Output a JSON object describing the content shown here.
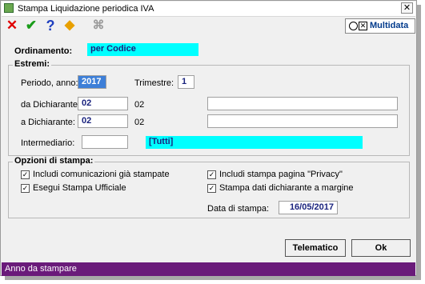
{
  "window": {
    "title": "Stampa Liquidazione periodica IVA",
    "close_label": "✕"
  },
  "toolbar": {
    "cancel_icon": "✕",
    "confirm_icon": "✔",
    "help_icon": "?",
    "tool_icon": "◆",
    "binoculars_icon": "⌘",
    "brand_box": "✕",
    "brand_text": "Multidata"
  },
  "ordinamento": {
    "label": "Ordinamento:",
    "value": "per Codice"
  },
  "estremi": {
    "title": "Estremi:",
    "periodo_label": "Periodo, anno:",
    "anno_value": "2017",
    "trimestre_label": "Trimestre:",
    "trimestre_value": "1",
    "da_label": "da Dichiarante:",
    "da_code": "02",
    "da_text": "02",
    "a_label": "a Dichiarante:",
    "a_code": "02",
    "a_text": "02",
    "intermediario_label": "Intermediario:",
    "intermediario_code": "",
    "intermediario_value": "[Tutti]"
  },
  "opzioni": {
    "title": "Opzioni di stampa:",
    "check_mark": "✓",
    "options": [
      {
        "label": "Includi comunicazioni già stampate",
        "checked": true
      },
      {
        "label": "Esegui Stampa Ufficiale",
        "checked": true
      },
      {
        "label": "Includi stampa pagina \"Privacy\"",
        "checked": true
      },
      {
        "label": "Stampa dati dichiarante a margine",
        "checked": true
      }
    ],
    "data_label": "Data di stampa:",
    "data_value": "16/05/2017"
  },
  "buttons": {
    "telematico": "Telematico",
    "ok": "Ok"
  },
  "status": {
    "text": "Anno da stampare"
  },
  "colors": {
    "accent": "#00ffff",
    "status_bar": "#6a1b7a",
    "cancel": "#e00000",
    "confirm": "#1a9c1a",
    "help": "#1f3fbf"
  }
}
